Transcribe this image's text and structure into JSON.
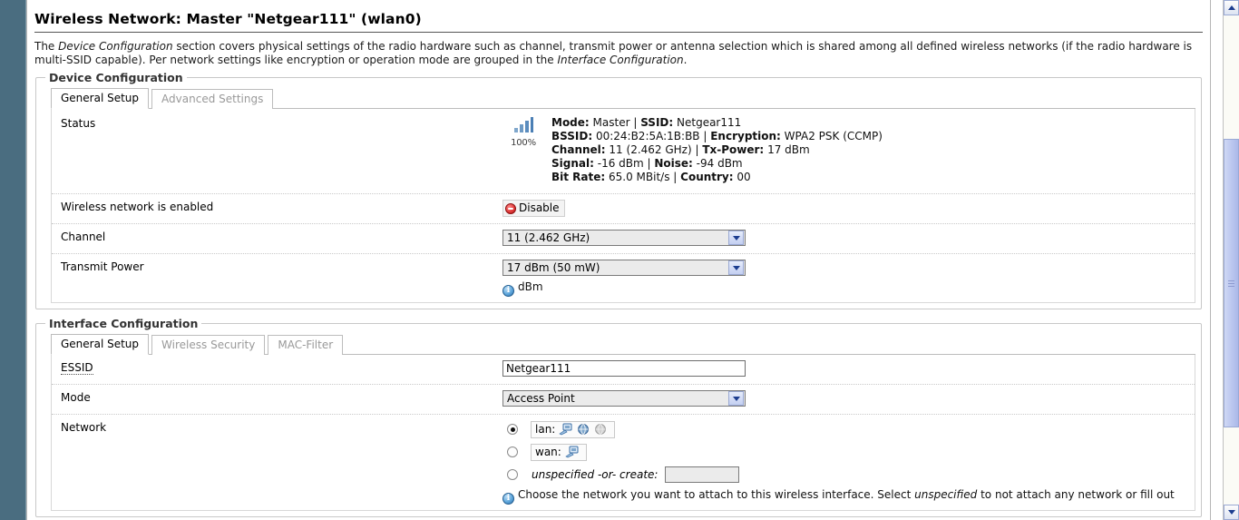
{
  "page": {
    "title": "Wireless Network: Master \"Netgear111\" (wlan0)",
    "desc_1": "The ",
    "desc_em1": "Device Configuration",
    "desc_2": " section covers physical settings of the radio hardware such as channel, transmit power or antenna selection which is shared among all defined wireless networks (if the radio hardware is multi-SSID capable). Per network settings like encryption or operation mode are grouped in the ",
    "desc_em2": "Interface Configuration",
    "desc_3": "."
  },
  "device_config": {
    "legend": "Device Configuration",
    "tabs": [
      {
        "label": "General Setup",
        "active": true
      },
      {
        "label": "Advanced Settings",
        "active": false
      }
    ],
    "status": {
      "label": "Status",
      "signal_percent": "100%",
      "signal_icon": "signal-bars-icon",
      "lines": [
        {
          "pairs": [
            {
              "k": "Mode:",
              "v": "Master"
            },
            {
              "k": "SSID:",
              "v": "Netgear111"
            }
          ]
        },
        {
          "pairs": [
            {
              "k": "BSSID:",
              "v": "00:24:B2:5A:1B:BB"
            },
            {
              "k": "Encryption:",
              "v": "WPA2 PSK (CCMP)"
            }
          ]
        },
        {
          "pairs": [
            {
              "k": "Channel:",
              "v": "11 (2.462 GHz)"
            },
            {
              "k": "Tx-Power:",
              "v": "17 dBm"
            }
          ]
        },
        {
          "pairs": [
            {
              "k": "Signal:",
              "v": "-16 dBm"
            },
            {
              "k": "Noise:",
              "v": "-94 dBm"
            }
          ]
        },
        {
          "pairs": [
            {
              "k": "Bit Rate:",
              "v": "65.0 MBit/s"
            },
            {
              "k": "Country:",
              "v": "00"
            }
          ]
        }
      ]
    },
    "enabled_row": {
      "label": "Wireless network is enabled",
      "button_label": "Disable",
      "button_icon": "red-stop-icon"
    },
    "channel_row": {
      "label": "Channel",
      "value": "11 (2.462 GHz)"
    },
    "txpower_row": {
      "label": "Transmit Power",
      "value": "17 dBm (50 mW)",
      "hint": "dBm",
      "hint_icon": "info-icon"
    }
  },
  "interface_config": {
    "legend": "Interface Configuration",
    "tabs": [
      {
        "label": "General Setup",
        "active": true
      },
      {
        "label": "Wireless Security",
        "active": false
      },
      {
        "label": "MAC-Filter",
        "active": false
      }
    ],
    "essid_row": {
      "label": "ESSID",
      "value": "Netgear111"
    },
    "mode_row": {
      "label": "Mode",
      "value": "Access Point"
    },
    "network_row": {
      "label": "Network",
      "options": [
        {
          "name": "lan:",
          "selected": true,
          "icons": [
            "ethernet-icon",
            "wifi-active-icon",
            "wifi-inactive-icon"
          ]
        },
        {
          "name": "wan:",
          "selected": false,
          "icons": [
            "ethernet-icon"
          ]
        }
      ],
      "create_option": {
        "selected": false,
        "label": "unspecified -or- create:",
        "input_value": ""
      },
      "hint_icon": "info-icon",
      "hint": "Choose the network you want to attach to this wireless interface. Select ",
      "hint_em": "unspecified",
      "hint_tail": " to not attach any network or fill out"
    }
  },
  "scrollbar": {
    "up_icon": "chevron-up-icon",
    "down_icon": "chevron-down-icon",
    "thumb": "scrollbar-thumb"
  },
  "colors": {
    "page_bg": "#4a6d80",
    "accent": "#1c3d8f",
    "disable_red": "#e23b3b",
    "info_blue": "#5fa7dc"
  }
}
